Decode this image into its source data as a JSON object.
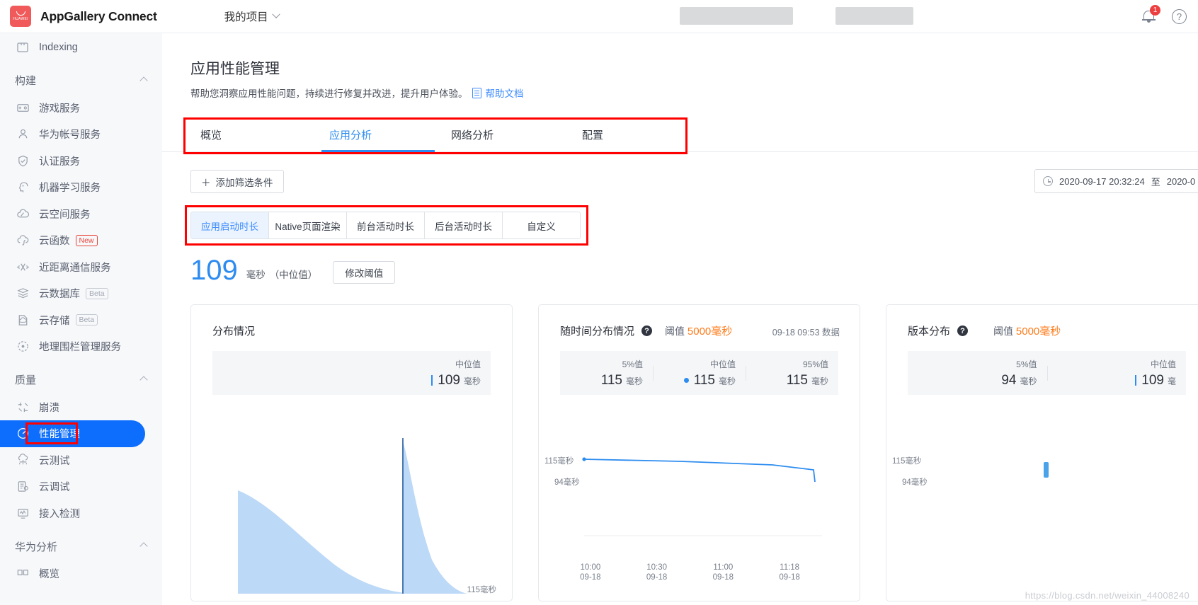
{
  "topbar": {
    "logo_text": "HUAWEI",
    "brand": "AppGallery Connect",
    "project_label": "我的项目",
    "notification_count": "1",
    "help_glyph": "?"
  },
  "sidebar": {
    "items_top": [
      {
        "label": "Indexing",
        "icon": "indexing-icon"
      }
    ],
    "sections": [
      {
        "title": "构建",
        "items": [
          {
            "label": "游戏服务",
            "icon": "game-icon",
            "tag": ""
          },
          {
            "label": "华为帐号服务",
            "icon": "account-icon",
            "tag": ""
          },
          {
            "label": "认证服务",
            "icon": "auth-shield-icon",
            "tag": ""
          },
          {
            "label": "机器学习服务",
            "icon": "ml-head-icon",
            "tag": ""
          },
          {
            "label": "云空间服务",
            "icon": "cloud-space-icon",
            "tag": ""
          },
          {
            "label": "云函数",
            "icon": "cloud-function-icon",
            "tag": "New"
          },
          {
            "label": "近距离通信服务",
            "icon": "nearby-icon",
            "tag": ""
          },
          {
            "label": "云数据库",
            "icon": "cloud-db-icon",
            "tag": "Beta"
          },
          {
            "label": "云存储",
            "icon": "cloud-storage-icon",
            "tag": "Beta"
          },
          {
            "label": "地理围栏管理服务",
            "icon": "geofence-icon",
            "tag": ""
          }
        ]
      },
      {
        "title": "质量",
        "items": [
          {
            "label": "崩溃",
            "icon": "crash-icon",
            "tag": ""
          },
          {
            "label": "性能管理",
            "icon": "performance-gauge-icon",
            "tag": "",
            "active": true
          },
          {
            "label": "云测试",
            "icon": "cloud-test-icon",
            "tag": ""
          },
          {
            "label": "云调试",
            "icon": "cloud-debug-icon",
            "tag": ""
          },
          {
            "label": "接入检测",
            "icon": "access-check-icon",
            "tag": ""
          }
        ]
      },
      {
        "title": "华为分析",
        "items": [
          {
            "label": "概览",
            "icon": "overview-icon",
            "tag": ""
          }
        ]
      }
    ]
  },
  "page": {
    "title": "应用性能管理",
    "subtitle": "帮助您洞察应用性能问题，持续进行修复并改进，提升用户体验。",
    "doc_link": "帮助文档"
  },
  "tabs": [
    {
      "label": "概览",
      "active": false
    },
    {
      "label": "应用分析",
      "active": true
    },
    {
      "label": "网络分析",
      "active": false
    },
    {
      "label": "配置",
      "active": false
    }
  ],
  "filter": {
    "add_filter_label": "添加筛选条件",
    "add_filter_plus": "＋",
    "date_start": "2020-09-17 20:32:24",
    "date_sep": "至",
    "date_end": "2020-0"
  },
  "metric_tabs": [
    {
      "label": "应用启动时长",
      "active": true
    },
    {
      "label": "Native页面渲染",
      "active": false
    },
    {
      "label": "前台活动时长",
      "active": false
    },
    {
      "label": "后台活动时长",
      "active": false
    },
    {
      "label": "自定义",
      "active": false
    }
  ],
  "metric": {
    "value": "109",
    "unit": "毫秒",
    "note": "（中位值）",
    "button": "修改阈值"
  },
  "cards": [
    {
      "title": "分布情况",
      "has_help": false,
      "threshold_label": "",
      "threshold_value": "",
      "asof": "",
      "stats": [
        {
          "label": "中位值",
          "value": "109",
          "unit": "毫秒",
          "marker": "bar"
        }
      ],
      "xaxis_right_label": "115毫秒"
    },
    {
      "title": "随时间分布情况",
      "has_help": true,
      "threshold_label": "阈值",
      "threshold_value": "5000毫秒",
      "asof": "09-18 09:53 数据",
      "stats": [
        {
          "label": "5%值",
          "value": "115",
          "unit": "毫秒",
          "marker": "none"
        },
        {
          "label": "中位值",
          "value": "115",
          "unit": "毫秒",
          "marker": "dot"
        },
        {
          "label": "95%值",
          "value": "115",
          "unit": "毫秒",
          "marker": "none"
        }
      ],
      "ylabels": [
        "115毫秒",
        "94毫秒"
      ],
      "xticks": [
        {
          "time": "10:00",
          "date": "09-18"
        },
        {
          "time": "10:30",
          "date": "09-18"
        },
        {
          "time": "11:00",
          "date": "09-18"
        },
        {
          "time": "11:18",
          "date": "09-18"
        }
      ]
    },
    {
      "title": "版本分布",
      "has_help": true,
      "threshold_label": "阈值",
      "threshold_value": "5000毫秒",
      "asof": "",
      "stats": [
        {
          "label": "5%值",
          "value": "94",
          "unit": "毫秒",
          "marker": "none"
        },
        {
          "label": "中位值",
          "value": "109",
          "unit": "毫",
          "marker": "bar"
        }
      ],
      "ylabels": [
        "115毫秒",
        "94毫秒"
      ]
    }
  ],
  "chart_data": [
    {
      "type": "area",
      "title": "分布情况",
      "xlabel": "",
      "ylabel": "",
      "annotations": [
        {
          "text": "115毫秒",
          "position": "bottom-right"
        }
      ],
      "median_marker": 109,
      "x": [
        0,
        5,
        12,
        20,
        30,
        40,
        50,
        60,
        70,
        80,
        90,
        95,
        100
      ],
      "values": [
        72,
        70,
        60,
        50,
        41,
        33,
        26,
        20,
        15,
        11,
        8,
        4,
        0
      ],
      "second_peak": {
        "x": 100,
        "height": 96,
        "decay_to": 0
      }
    },
    {
      "type": "line",
      "title": "随时间分布情况",
      "xlabel": "",
      "ylabel": "毫秒",
      "ylim": [
        94,
        115
      ],
      "ytick_labels": [
        "115毫秒",
        "94毫秒"
      ],
      "categories": [
        "10:00 09-18",
        "10:30 09-18",
        "11:00 09-18",
        "11:18 09-18"
      ],
      "series": [
        {
          "name": "中位值",
          "values": [
            115,
            114,
            113,
            110
          ]
        }
      ],
      "grid": false,
      "legend": "none"
    },
    {
      "type": "bar",
      "title": "版本分布",
      "xlabel": "",
      "ylabel": "毫秒",
      "ylim": [
        94,
        115
      ],
      "ytick_labels": [
        "115毫秒",
        "94毫秒"
      ],
      "categories": [
        ""
      ],
      "values": [
        109
      ]
    }
  ],
  "watermark": "https://blog.csdn.net/weixin_44008240",
  "colors": {
    "accent": "#2d8cf0",
    "active_nav": "#0d6efd",
    "brand_red": "#f05a5a",
    "threshold_orange": "#ff7a18",
    "highlight_box": "#ff0000",
    "area_fill": "#bcd9f7"
  }
}
